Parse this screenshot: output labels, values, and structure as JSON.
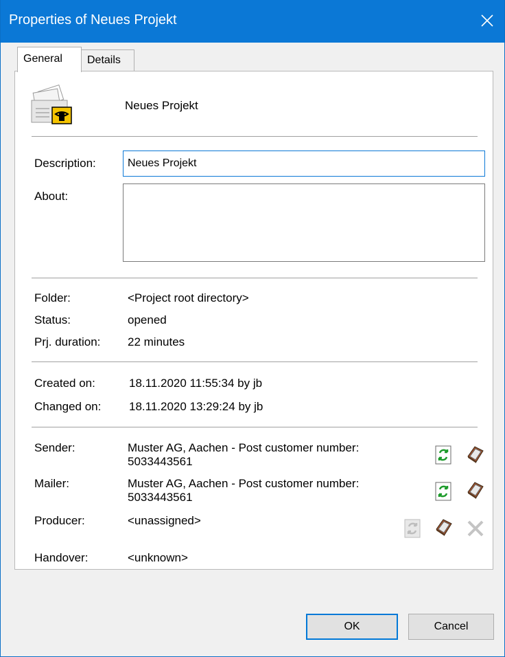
{
  "window": {
    "title": "Properties of Neues Projekt",
    "close_icon": "close-icon"
  },
  "tabs": [
    {
      "label": "General",
      "active": true
    },
    {
      "label": "Details",
      "active": false
    }
  ],
  "header": {
    "project_name": "Neues Projekt",
    "icon": "project-mail-icon"
  },
  "fields": {
    "description_label": "Description:",
    "description_value": "Neues Projekt",
    "about_label": "About:",
    "about_value": ""
  },
  "info": {
    "folder_label": "Folder:",
    "folder_value": "<Project root directory>",
    "status_label": "Status:",
    "status_value": "opened",
    "duration_label": "Prj. duration:",
    "duration_value": "22 minutes"
  },
  "dates": {
    "created_label": "Created on:",
    "created_value": "18.11.2020 11:55:34 by jb",
    "changed_label": "Changed on:",
    "changed_value": "18.11.2020 13:29:24 by jb"
  },
  "parties": {
    "sender_label": "Sender:",
    "sender_line1": "Muster AG, Aachen - Post customer number:",
    "sender_line2": "5033443561",
    "mailer_label": "Mailer:",
    "mailer_line1": "Muster AG, Aachen - Post customer number:",
    "mailer_line2": "5033443561",
    "producer_label": "Producer:",
    "producer_value": "<unassigned>",
    "handover_label": "Handover:",
    "handover_value": "<unknown>"
  },
  "buttons": {
    "ok": "OK",
    "cancel": "Cancel"
  },
  "colors": {
    "titlebar": "#0b78d6",
    "accent": "#0078d7"
  }
}
